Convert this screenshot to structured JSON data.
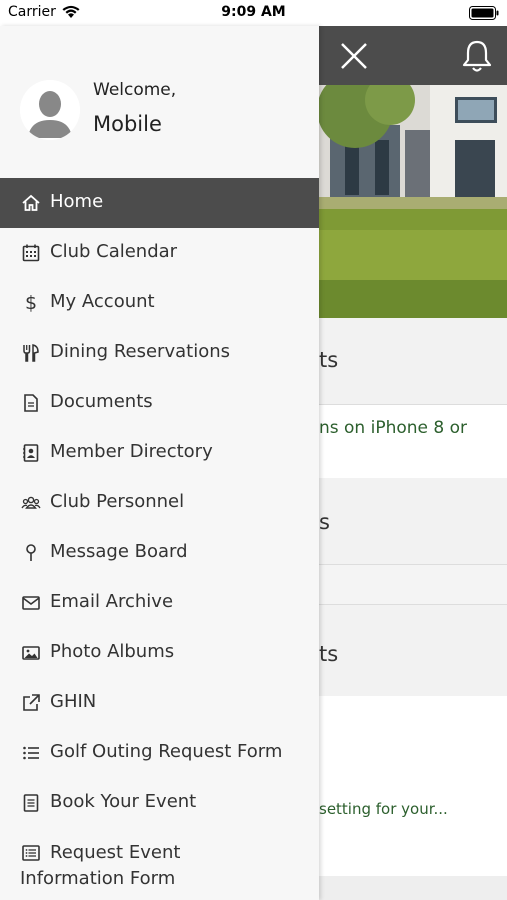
{
  "status_bar": {
    "carrier": "Carrier",
    "time": "9:09 AM"
  },
  "drawer": {
    "welcome": "Welcome,",
    "username": "Mobile",
    "items": [
      {
        "label": "Home",
        "icon": "home-icon",
        "active": true
      },
      {
        "label": "Club Calendar",
        "icon": "calendar-icon"
      },
      {
        "label": "My Account",
        "icon": "dollar-icon"
      },
      {
        "label": "Dining Reservations",
        "icon": "dining-icon"
      },
      {
        "label": "Documents",
        "icon": "document-icon"
      },
      {
        "label": "Member Directory",
        "icon": "directory-icon"
      },
      {
        "label": "Club Personnel",
        "icon": "people-icon"
      },
      {
        "label": "Message Board",
        "icon": "pin-icon"
      },
      {
        "label": "Email Archive",
        "icon": "email-icon"
      },
      {
        "label": "Photo Albums",
        "icon": "photo-icon"
      },
      {
        "label": "GHIN",
        "icon": "external-link-icon"
      },
      {
        "label": "Golf Outing Request Form",
        "icon": "list-icon"
      },
      {
        "label": "Book Your Event",
        "icon": "form-icon"
      },
      {
        "label": "Request Event Information Form",
        "icon": "form-list-icon"
      }
    ]
  },
  "background_content": {
    "section1_title_fragment": "ts",
    "news_text_fragment": "ns on iPhone 8 or",
    "section2_title_fragment": "s",
    "section3_title_fragment": "ts",
    "teaser_fragment": "setting for your..."
  },
  "colors": {
    "topbar": "#4c4c4c",
    "active_item": "#4c4c4c",
    "news_link": "#2c5f2d"
  }
}
